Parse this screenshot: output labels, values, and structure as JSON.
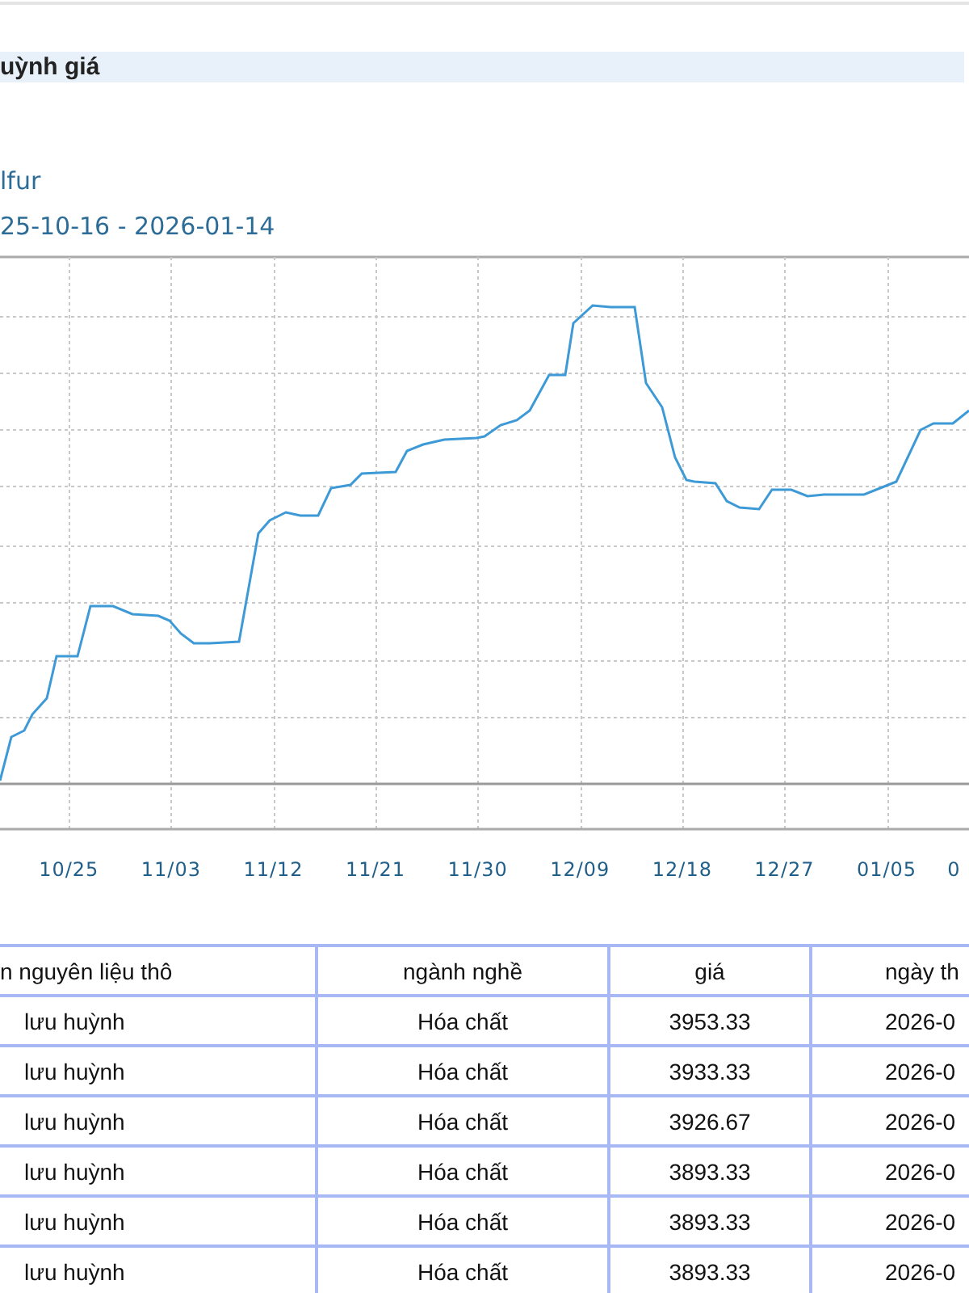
{
  "section_heading": "uỳnh giá",
  "chart": {
    "title": "lfur",
    "date_range": "25-10-16 - 2026-01-14",
    "x_labels": [
      "10/25",
      "11/03",
      "11/12",
      "11/21",
      "11/30",
      "12/09",
      "12/18",
      "12/27",
      "01/05",
      "0"
    ]
  },
  "table": {
    "columns": [
      "n nguyên liệu thô",
      "ngành nghề",
      "giá",
      "ngày th"
    ],
    "rows": [
      [
        "lưu huỳnh",
        "Hóa chất",
        "3953.33",
        "2026-0"
      ],
      [
        "lưu huỳnh",
        "Hóa chất",
        "3933.33",
        "2026-0"
      ],
      [
        "lưu huỳnh",
        "Hóa chất",
        "3926.67",
        "2026-0"
      ],
      [
        "lưu huỳnh",
        "Hóa chất",
        "3893.33",
        "2026-0"
      ],
      [
        "lưu huỳnh",
        "Hóa chất",
        "3893.33",
        "2026-0"
      ],
      [
        "lưu huỳnh",
        "Hóa chất",
        "3893.33",
        "2026-0"
      ]
    ]
  }
}
